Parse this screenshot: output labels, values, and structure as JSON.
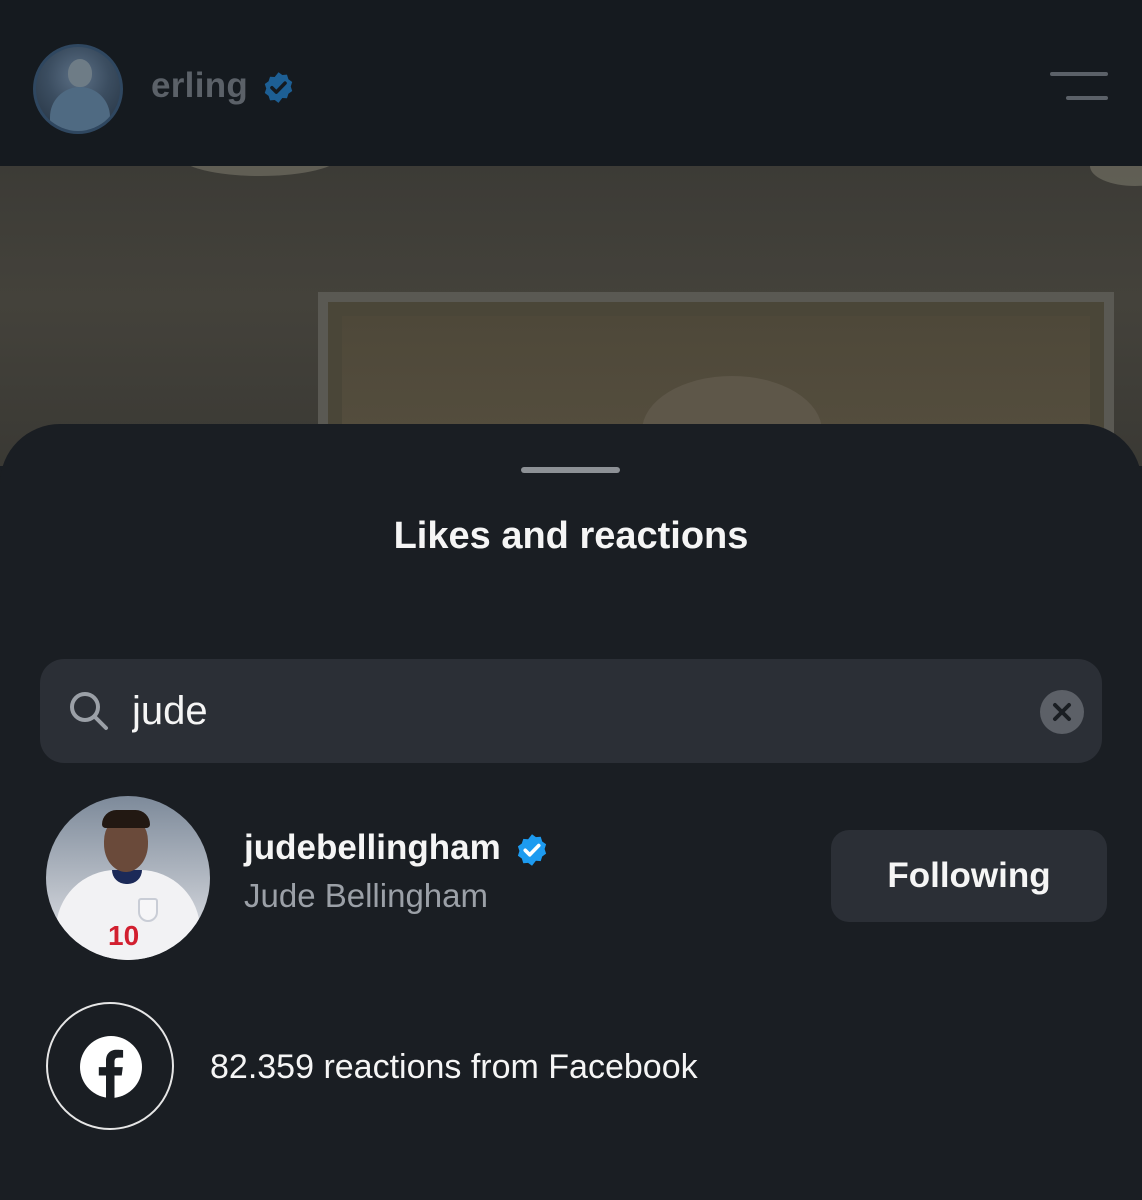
{
  "header": {
    "username": "erling",
    "verified": true,
    "menu_icon": "hamburger-menu-icon"
  },
  "sheet": {
    "title": "Likes and reactions"
  },
  "search": {
    "icon": "search-icon",
    "value": "jude",
    "clear_icon": "clear-x-icon"
  },
  "results": [
    {
      "username": "judebellingham",
      "verified": true,
      "full_name": "Jude Bellingham",
      "button_label": "Following",
      "avatar_jersey_number": "10"
    }
  ],
  "facebook": {
    "icon": "facebook-icon",
    "text": "82.359 reactions from Facebook"
  },
  "colors": {
    "background": "#1a1e23",
    "verified_blue": "#1d9bf0",
    "button_bg": "#2b2f36",
    "secondary_text": "#9ba0a7"
  }
}
